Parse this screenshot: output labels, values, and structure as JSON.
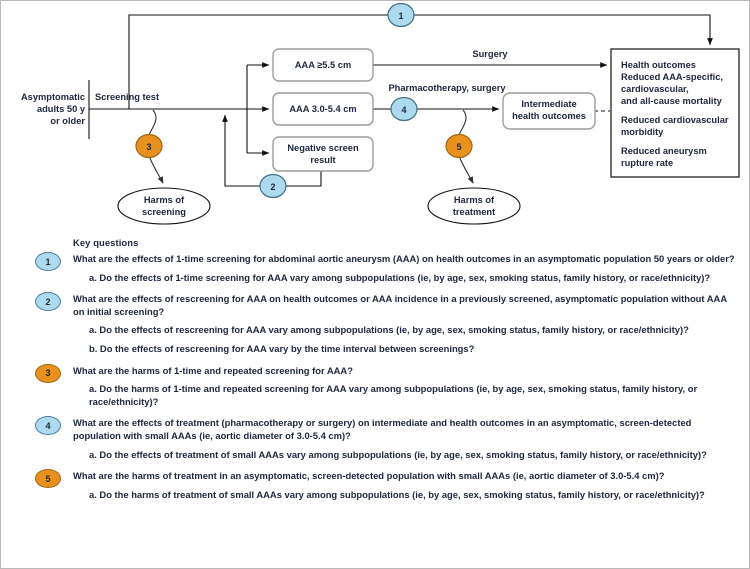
{
  "diagram": {
    "population_label": [
      "Asymptomatic",
      "adults 50 y",
      "or older"
    ],
    "screening_test_label": "Screening test",
    "boxes": {
      "aaa_large": "AAA ≥5.5 cm",
      "aaa_small": "AAA 3.0-5.4 cm",
      "negative": [
        "Negative screen",
        "result"
      ],
      "intermediate": [
        "Intermediate",
        "health outcomes"
      ]
    },
    "ellipses": {
      "harms_screening": [
        "Harms of",
        "screening"
      ],
      "harms_treatment": [
        "Harms of",
        "treatment"
      ]
    },
    "edge_labels": {
      "surgery": "Surgery",
      "pharmacotherapy_surgery": "Pharmacotherapy, surgery"
    },
    "outcomes_box": {
      "title": "Health outcomes",
      "lines": [
        [
          "Reduced AAA-specific,",
          "cardiovascular,",
          "and all-cause mortality"
        ],
        [
          "Reduced cardiovascular",
          "morbidity"
        ],
        [
          "Reduced aneurysm",
          "rupture rate"
        ]
      ]
    },
    "badges": [
      {
        "num": "1",
        "color": "blue"
      },
      {
        "num": "2",
        "color": "blue"
      },
      {
        "num": "3",
        "color": "orange"
      },
      {
        "num": "4",
        "color": "blue"
      },
      {
        "num": "5",
        "color": "orange"
      }
    ],
    "colors": {
      "blue_fill": "#aedaf0",
      "blue_stroke": "#3f6f87",
      "orange_fill": "#e8911f",
      "orange_stroke": "#a5650f",
      "line": "#111111",
      "box_stroke": "#9c9c9c",
      "text": "#20293f"
    }
  },
  "key_questions": {
    "header": "Key questions",
    "items": [
      {
        "num": "1",
        "color": "blue",
        "main": "What are the effects of 1-time screening for abdominal aortic aneurysm (AAA) on health outcomes in an asymptomatic population 50 years or older?",
        "subs": [
          "a. Do the effects of 1-time screening for AAA vary among subpopulations (ie, by age, sex, smoking status, family history, or race/ethnicity)?"
        ]
      },
      {
        "num": "2",
        "color": "blue",
        "main": "What are the effects of rescreening for AAA on health outcomes or AAA incidence in a previously screened, asymptomatic population without AAA on initial screening?",
        "subs": [
          "a. Do the effects of rescreening for AAA vary among subpopulations (ie, by age, sex, smoking status, family history, or race/ethnicity)?",
          "b. Do the effects of rescreening for AAA vary by the time interval between screenings?"
        ]
      },
      {
        "num": "3",
        "color": "orange",
        "main": "What are the harms of 1-time and repeated screening for AAA?",
        "subs": [
          "a. Do the harms of 1-time and repeated screening for AAA vary among subpopulations (ie, by age, sex, smoking status, family history, or race/ethnicity)?"
        ]
      },
      {
        "num": "4",
        "color": "blue",
        "main": "What are the effects of treatment (pharmacotherapy or surgery) on intermediate and health outcomes in an asymptomatic, screen-detected population with small AAAs (ie, aortic diameter of 3.0-5.4 cm)?",
        "subs": [
          "a. Do the effects of treatment of small AAAs vary among subpopulations (ie, by age, sex, smoking status, family history, or race/ethnicity)?"
        ]
      },
      {
        "num": "5",
        "color": "orange",
        "main": "What are the harms of treatment in an asymptomatic, screen-detected population with small AAAs (ie, aortic diameter of 3.0-5.4 cm)?",
        "subs": [
          "a. Do the harms of treatment of small AAAs vary among subpopulations (ie, by age, sex, smoking status, family history, or race/ethnicity)?"
        ]
      }
    ]
  }
}
